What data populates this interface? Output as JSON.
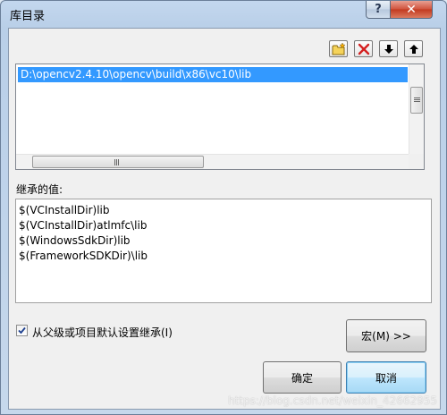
{
  "window": {
    "title": "库目录"
  },
  "titlebar": {
    "help_label": "?",
    "close_label": "✕"
  },
  "toolbar": {
    "new_folder_icon": "new-folder-icon",
    "delete_icon": "delete-icon",
    "move_down_icon": "arrow-down-icon",
    "move_up_icon": "arrow-up-icon"
  },
  "directory_list": {
    "items": [
      "D:\\opencv2.4.10\\opencv\\build\\x86\\vc10\\lib"
    ],
    "selected_index": 0
  },
  "inherited": {
    "label": "继承的值:",
    "items": [
      "$(VCInstallDir)lib",
      "$(VCInstallDir)atlmfc\\lib",
      "$(WindowsSdkDir)lib",
      "$(FrameworkSDKDir)\\lib"
    ]
  },
  "inherit_checkbox": {
    "label": "从父级或项目默认设置继承(I)",
    "checked": true
  },
  "buttons": {
    "macro": "宏(M) >>",
    "ok": "确定",
    "cancel": "取消"
  },
  "watermark": "https://blog.csdn.net/weixin_42662955",
  "colors": {
    "selection": "#3399ff",
    "delete_red": "#d42020",
    "folder_yellow": "#f5d35a"
  }
}
